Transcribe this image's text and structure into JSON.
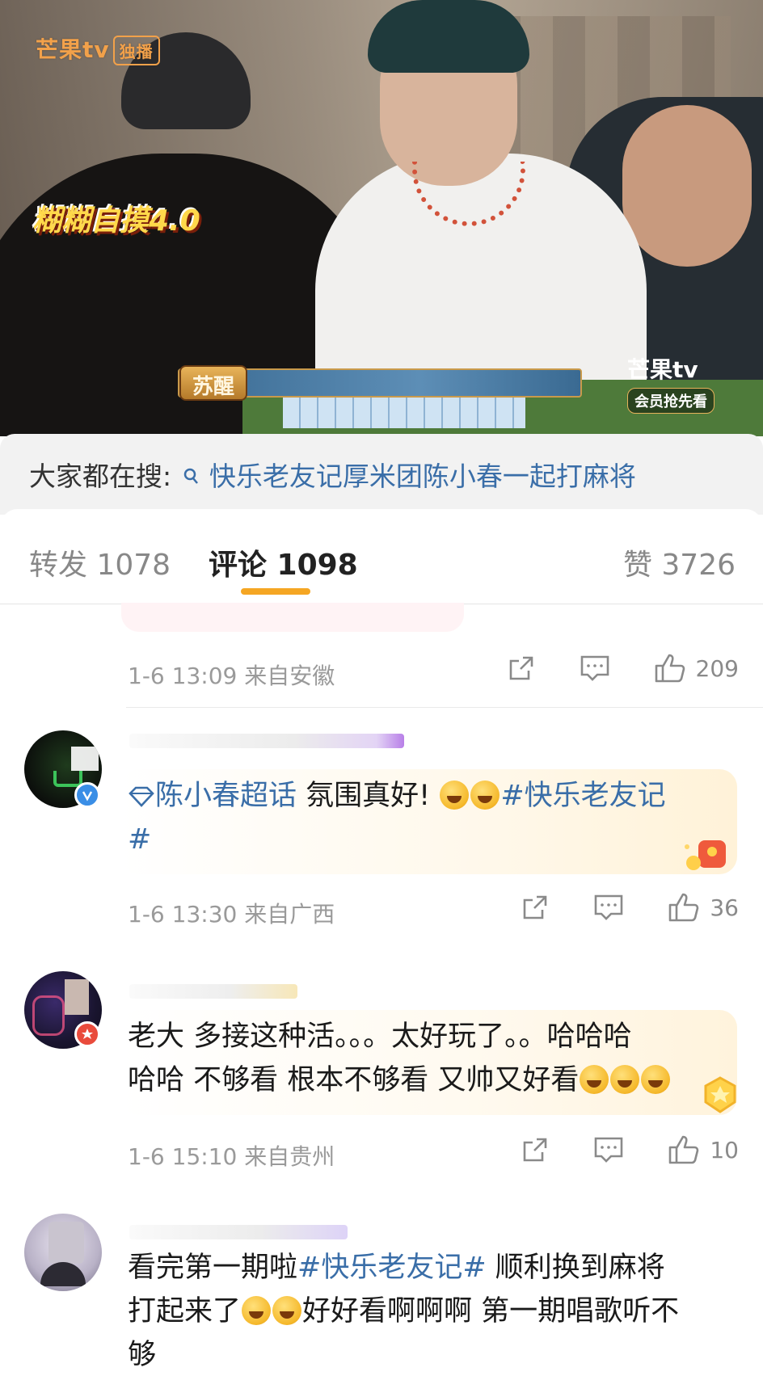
{
  "video": {
    "logo_top_left": "芒果tv",
    "logo_top_left_tag": "独播",
    "caption_badge": "糊糊自摸4.0",
    "name_chip": "苏醒",
    "logo_bottom_right": "芒果tv",
    "logo_bottom_right_sub": "会员抢先看"
  },
  "search": {
    "prefix": "大家都在搜:",
    "query": "快乐老友记厚米团陈小春一起打麻将"
  },
  "tabs": {
    "repost": "转发 1078",
    "comment": "评论 1098",
    "like": "赞 3726"
  },
  "comments": [
    {
      "meta": "1-6 13:09  来自安徽",
      "likes": "209"
    },
    {
      "text_link1": "陈小春超话",
      "text_plain1": " 氛围真好! ",
      "text_link2": "#快乐老友记",
      "text_link3": "#",
      "meta": "1-6 13:30  来自广西",
      "likes": "36",
      "badge_color": "#3a8ee6"
    },
    {
      "text_line1": "老大 多接这种活。。。太好玩了。。哈哈哈",
      "text_line2": "哈哈 不够看 根本不够看 又帅又好看",
      "meta": "1-6 15:10  来自贵州",
      "likes": "10",
      "badge_color": "#e94b3c"
    },
    {
      "text_line1a": "看完第一期啦",
      "text_line1_link": "#快乐老友记#",
      "text_line1b": "  顺利换到麻将",
      "text_line2a": "打起来了",
      "text_line2b": "好好看啊啊啊  第一期唱歌听不",
      "text_line3": "够"
    }
  ],
  "colors": {
    "link": "#3a6ea8",
    "tab_underline": "#f5a623",
    "meta": "#9a9a9a"
  }
}
